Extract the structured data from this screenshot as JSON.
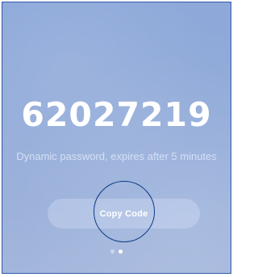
{
  "code": {
    "value": "62027219"
  },
  "subtitle": {
    "text": "Dynamic password, expires after 5 minutes"
  },
  "copy_button": {
    "label": "Copy Code"
  },
  "pagination": {
    "total": 2,
    "active_index": 1
  },
  "colors": {
    "frame_border": "#2f5aa8",
    "background_top": "#8da8d9",
    "background_bottom": "#a3b6dc",
    "touch_ring": "#0c3b86"
  }
}
